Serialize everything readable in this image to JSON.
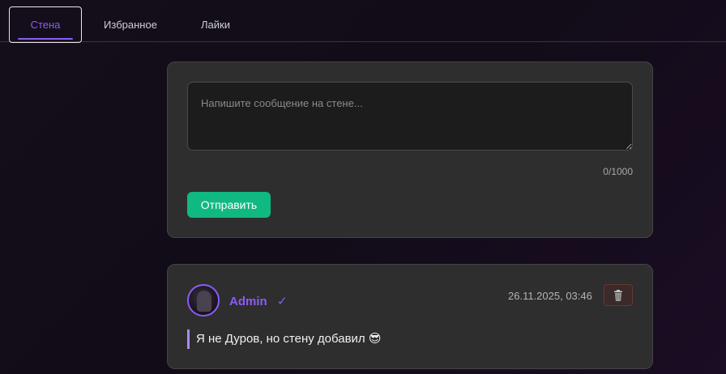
{
  "tabs": [
    {
      "label": "Стена",
      "active": true
    },
    {
      "label": "Избранное",
      "active": false
    },
    {
      "label": "Лайки",
      "active": false
    }
  ],
  "composer": {
    "placeholder": "Напишите сообщение на стене...",
    "value": "",
    "counter": "0/1000",
    "send_label": "Отправить"
  },
  "post": {
    "author": "Admin",
    "verified_mark": "✓",
    "timestamp": "26.11.2025, 03:46",
    "text": "Я не Дуров, но стену добавил 😎",
    "avatar_icon": "avatar-image",
    "delete_icon": "trash-icon"
  },
  "colors": {
    "accent": "#8b5cf6",
    "send_button": "#10b981",
    "card_bg": "#2e2e2e",
    "page_bg": "#140e1a"
  }
}
